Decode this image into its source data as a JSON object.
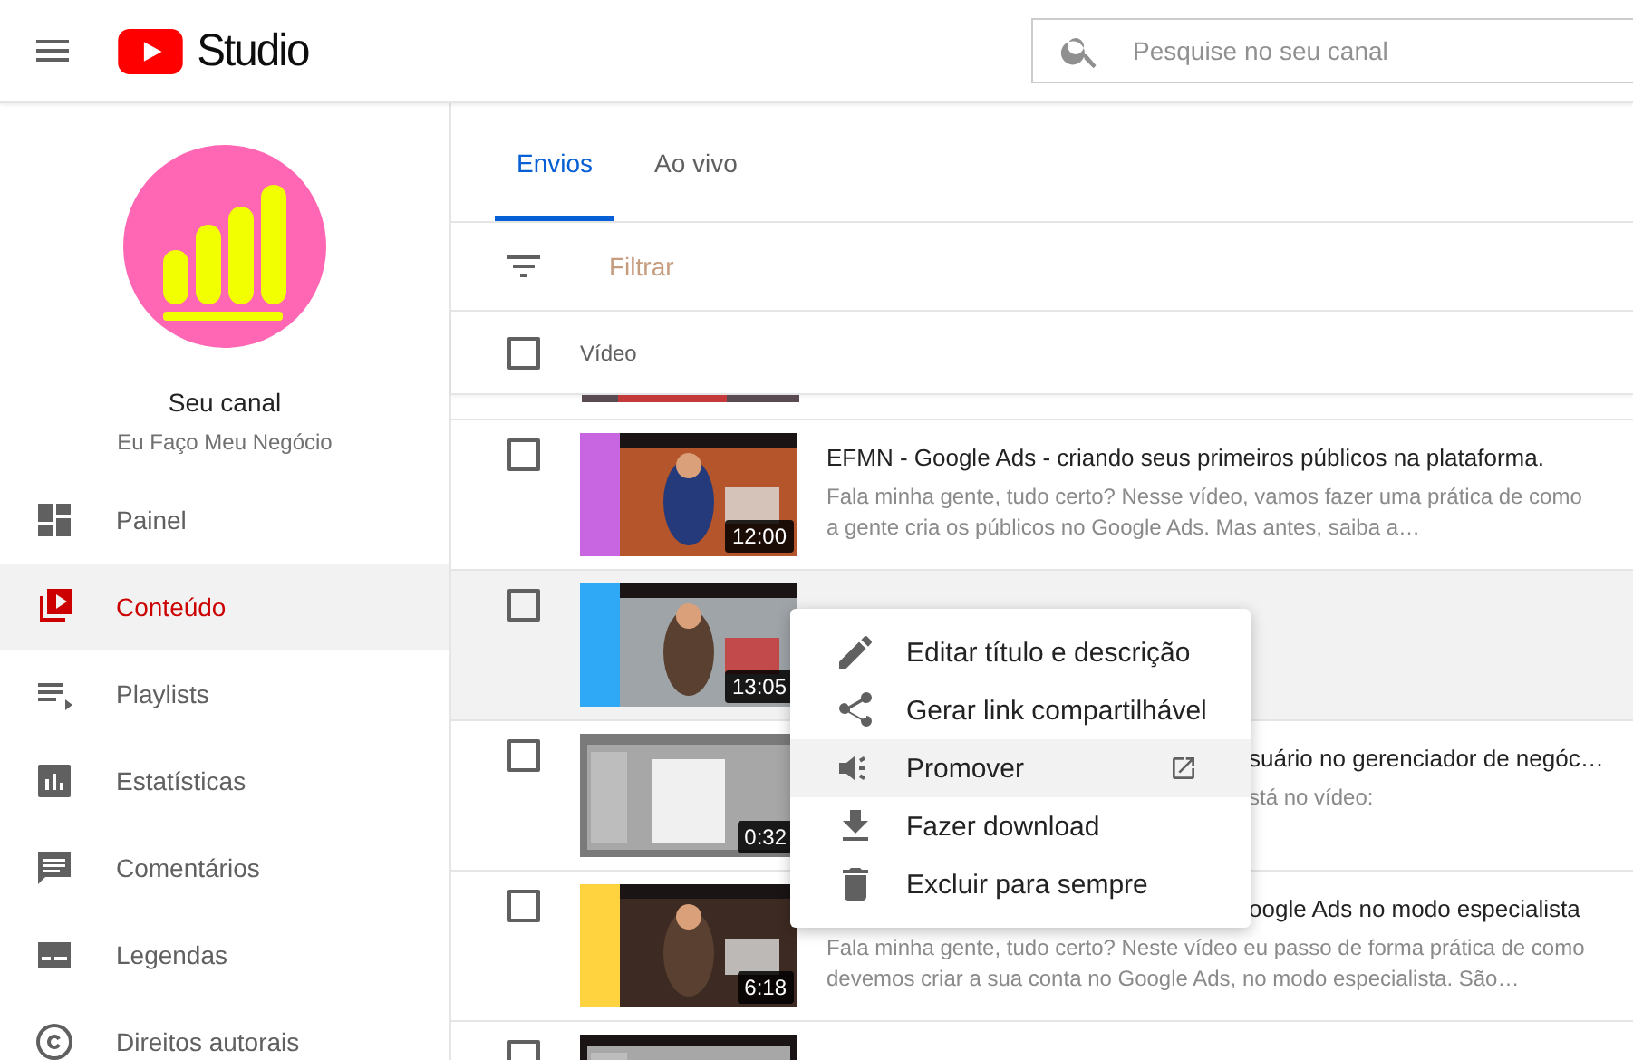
{
  "header": {
    "brand": "Studio",
    "search_placeholder": "Pesquise no seu canal"
  },
  "channel": {
    "title": "Seu canal",
    "name": "Eu Faço Meu Negócio"
  },
  "nav": [
    {
      "label": "Painel",
      "selected": false
    },
    {
      "label": "Conteúdo",
      "selected": true
    },
    {
      "label": "Playlists",
      "selected": false
    },
    {
      "label": "Estatísticas",
      "selected": false
    },
    {
      "label": "Comentários",
      "selected": false
    },
    {
      "label": "Legendas",
      "selected": false
    },
    {
      "label": "Direitos autorais",
      "selected": false
    }
  ],
  "tabs": [
    {
      "label": "Envios",
      "selected": true
    },
    {
      "label": "Ao vivo",
      "selected": false
    }
  ],
  "filter": {
    "placeholder": "Filtrar"
  },
  "table": {
    "header_checked": false,
    "column_header": "Vídeo",
    "rows": [
      {
        "checked": false,
        "hovered": false,
        "duration": "12:00",
        "title": "EFMN - Google Ads - criando seus primeiros públicos na plataforma.",
        "title_covered": false,
        "description": "Fala minha gente, tudo certo? Nesse vídeo, vamos fazer uma prática de como a gente cria os públicos no Google Ads. Mas antes, saiba a…",
        "description_covered": false
      },
      {
        "checked": false,
        "hovered": true,
        "duration": "13:05"
      },
      {
        "checked": false,
        "hovered": false,
        "duration": "0:32",
        "title": "suário no gerenciador de negóc…",
        "title_covered": true,
        "description": "stá no vídeo:",
        "description_covered": true
      },
      {
        "checked": false,
        "hovered": false,
        "duration": "6:18",
        "title": "oogle Ads no modo especialista",
        "title_covered": true,
        "description": "Fala minha gente, tudo certo? Neste vídeo eu passo de forma prática de como devemos criar a sua conta no Google Ads, no modo especialista. São…",
        "description_covered": false
      },
      {
        "checked": false,
        "hovered": false
      }
    ]
  },
  "menu": [
    {
      "label": "Editar título e descrição",
      "highlighted": false,
      "external": false
    },
    {
      "label": "Gerar link compartilhável",
      "highlighted": false,
      "external": false
    },
    {
      "label": "Promover",
      "highlighted": true,
      "external": true
    },
    {
      "label": "Fazer download",
      "highlighted": false,
      "external": false
    },
    {
      "label": "Excluir para sempre",
      "highlighted": false,
      "external": false
    }
  ]
}
